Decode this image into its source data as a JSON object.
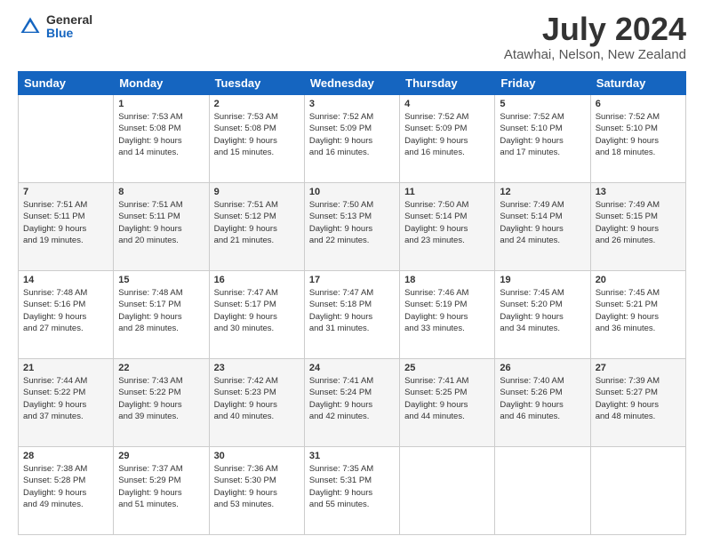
{
  "logo": {
    "general": "General",
    "blue": "Blue"
  },
  "header": {
    "month": "July 2024",
    "location": "Atawhai, Nelson, New Zealand"
  },
  "days_of_week": [
    "Sunday",
    "Monday",
    "Tuesday",
    "Wednesday",
    "Thursday",
    "Friday",
    "Saturday"
  ],
  "weeks": [
    [
      {
        "day": "",
        "info": ""
      },
      {
        "day": "1",
        "info": "Sunrise: 7:53 AM\nSunset: 5:08 PM\nDaylight: 9 hours\nand 14 minutes."
      },
      {
        "day": "2",
        "info": "Sunrise: 7:53 AM\nSunset: 5:08 PM\nDaylight: 9 hours\nand 15 minutes."
      },
      {
        "day": "3",
        "info": "Sunrise: 7:52 AM\nSunset: 5:09 PM\nDaylight: 9 hours\nand 16 minutes."
      },
      {
        "day": "4",
        "info": "Sunrise: 7:52 AM\nSunset: 5:09 PM\nDaylight: 9 hours\nand 16 minutes."
      },
      {
        "day": "5",
        "info": "Sunrise: 7:52 AM\nSunset: 5:10 PM\nDaylight: 9 hours\nand 17 minutes."
      },
      {
        "day": "6",
        "info": "Sunrise: 7:52 AM\nSunset: 5:10 PM\nDaylight: 9 hours\nand 18 minutes."
      }
    ],
    [
      {
        "day": "7",
        "info": "Sunrise: 7:51 AM\nSunset: 5:11 PM\nDaylight: 9 hours\nand 19 minutes."
      },
      {
        "day": "8",
        "info": "Sunrise: 7:51 AM\nSunset: 5:11 PM\nDaylight: 9 hours\nand 20 minutes."
      },
      {
        "day": "9",
        "info": "Sunrise: 7:51 AM\nSunset: 5:12 PM\nDaylight: 9 hours\nand 21 minutes."
      },
      {
        "day": "10",
        "info": "Sunrise: 7:50 AM\nSunset: 5:13 PM\nDaylight: 9 hours\nand 22 minutes."
      },
      {
        "day": "11",
        "info": "Sunrise: 7:50 AM\nSunset: 5:14 PM\nDaylight: 9 hours\nand 23 minutes."
      },
      {
        "day": "12",
        "info": "Sunrise: 7:49 AM\nSunset: 5:14 PM\nDaylight: 9 hours\nand 24 minutes."
      },
      {
        "day": "13",
        "info": "Sunrise: 7:49 AM\nSunset: 5:15 PM\nDaylight: 9 hours\nand 26 minutes."
      }
    ],
    [
      {
        "day": "14",
        "info": "Sunrise: 7:48 AM\nSunset: 5:16 PM\nDaylight: 9 hours\nand 27 minutes."
      },
      {
        "day": "15",
        "info": "Sunrise: 7:48 AM\nSunset: 5:17 PM\nDaylight: 9 hours\nand 28 minutes."
      },
      {
        "day": "16",
        "info": "Sunrise: 7:47 AM\nSunset: 5:17 PM\nDaylight: 9 hours\nand 30 minutes."
      },
      {
        "day": "17",
        "info": "Sunrise: 7:47 AM\nSunset: 5:18 PM\nDaylight: 9 hours\nand 31 minutes."
      },
      {
        "day": "18",
        "info": "Sunrise: 7:46 AM\nSunset: 5:19 PM\nDaylight: 9 hours\nand 33 minutes."
      },
      {
        "day": "19",
        "info": "Sunrise: 7:45 AM\nSunset: 5:20 PM\nDaylight: 9 hours\nand 34 minutes."
      },
      {
        "day": "20",
        "info": "Sunrise: 7:45 AM\nSunset: 5:21 PM\nDaylight: 9 hours\nand 36 minutes."
      }
    ],
    [
      {
        "day": "21",
        "info": "Sunrise: 7:44 AM\nSunset: 5:22 PM\nDaylight: 9 hours\nand 37 minutes."
      },
      {
        "day": "22",
        "info": "Sunrise: 7:43 AM\nSunset: 5:22 PM\nDaylight: 9 hours\nand 39 minutes."
      },
      {
        "day": "23",
        "info": "Sunrise: 7:42 AM\nSunset: 5:23 PM\nDaylight: 9 hours\nand 40 minutes."
      },
      {
        "day": "24",
        "info": "Sunrise: 7:41 AM\nSunset: 5:24 PM\nDaylight: 9 hours\nand 42 minutes."
      },
      {
        "day": "25",
        "info": "Sunrise: 7:41 AM\nSunset: 5:25 PM\nDaylight: 9 hours\nand 44 minutes."
      },
      {
        "day": "26",
        "info": "Sunrise: 7:40 AM\nSunset: 5:26 PM\nDaylight: 9 hours\nand 46 minutes."
      },
      {
        "day": "27",
        "info": "Sunrise: 7:39 AM\nSunset: 5:27 PM\nDaylight: 9 hours\nand 48 minutes."
      }
    ],
    [
      {
        "day": "28",
        "info": "Sunrise: 7:38 AM\nSunset: 5:28 PM\nDaylight: 9 hours\nand 49 minutes."
      },
      {
        "day": "29",
        "info": "Sunrise: 7:37 AM\nSunset: 5:29 PM\nDaylight: 9 hours\nand 51 minutes."
      },
      {
        "day": "30",
        "info": "Sunrise: 7:36 AM\nSunset: 5:30 PM\nDaylight: 9 hours\nand 53 minutes."
      },
      {
        "day": "31",
        "info": "Sunrise: 7:35 AM\nSunset: 5:31 PM\nDaylight: 9 hours\nand 55 minutes."
      },
      {
        "day": "",
        "info": ""
      },
      {
        "day": "",
        "info": ""
      },
      {
        "day": "",
        "info": ""
      }
    ]
  ]
}
